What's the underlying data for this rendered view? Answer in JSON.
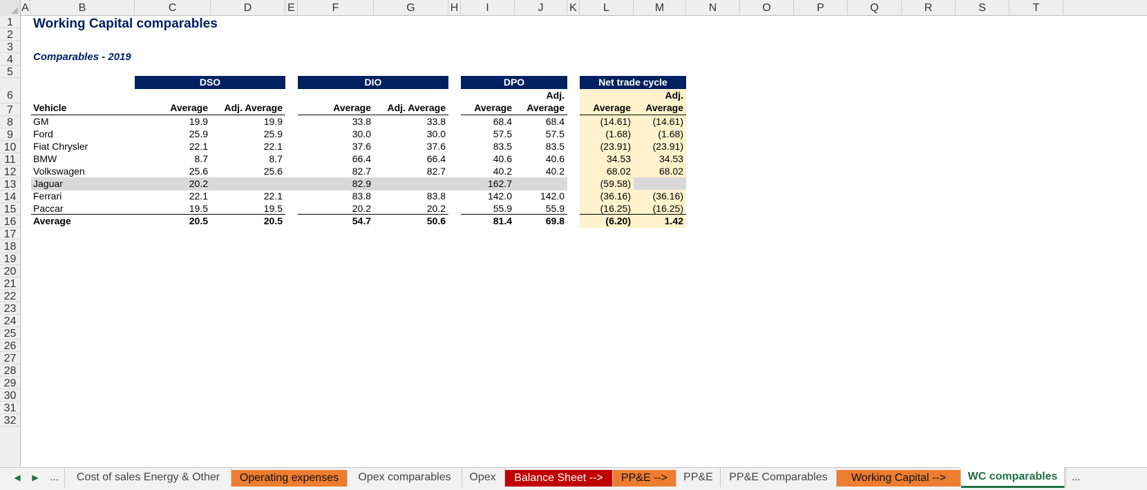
{
  "columns": [
    "A",
    "B",
    "C",
    "D",
    "E",
    "F",
    "G",
    "H",
    "I",
    "J",
    "K",
    "L",
    "M",
    "N",
    "O",
    "P",
    "Q",
    "R",
    "S",
    "T"
  ],
  "rows": [
    "1",
    "2",
    "3",
    "4",
    "5",
    "6",
    "7",
    "8",
    "9",
    "10",
    "11",
    "12",
    "13",
    "14",
    "15",
    "16",
    "17",
    "18",
    "19",
    "20",
    "21",
    "22",
    "23",
    "24",
    "25",
    "26",
    "27",
    "28",
    "29",
    "30",
    "31",
    "32"
  ],
  "sheet": {
    "title": "Working Capital comparables",
    "subtitle": "Comparables - 2019",
    "groups": [
      "DSO",
      "DIO",
      "DPO",
      "Net trade cycle"
    ],
    "header_adj": "Adj.",
    "header_average": "Average",
    "header_adj_average": "Adj. Average",
    "vehicle_label": "Vehicle",
    "data_rows": [
      {
        "name": "GM",
        "dso": "19.9",
        "dso_adj": "19.9",
        "dio": "33.8",
        "dio_adj": "33.8",
        "dpo": "68.4",
        "dpo_adj": "68.4",
        "ntc": "(14.61)",
        "ntc_adj": "(14.61)",
        "excluded": false
      },
      {
        "name": "Ford",
        "dso": "25.9",
        "dso_adj": "25.9",
        "dio": "30.0",
        "dio_adj": "30.0",
        "dpo": "57.5",
        "dpo_adj": "57.5",
        "ntc": "(1.68)",
        "ntc_adj": "(1.68)",
        "excluded": false
      },
      {
        "name": "Fiat Chrysler",
        "dso": "22.1",
        "dso_adj": "22.1",
        "dio": "37.6",
        "dio_adj": "37.6",
        "dpo": "83.5",
        "dpo_adj": "83.5",
        "ntc": "(23.91)",
        "ntc_adj": "(23.91)",
        "excluded": false
      },
      {
        "name": "BMW",
        "dso": "8.7",
        "dso_adj": "8.7",
        "dio": "66.4",
        "dio_adj": "66.4",
        "dpo": "40.6",
        "dpo_adj": "40.6",
        "ntc": "34.53",
        "ntc_adj": "34.53",
        "excluded": false
      },
      {
        "name": "Volkswagen",
        "dso": "25.6",
        "dso_adj": "25.6",
        "dio": "82.7",
        "dio_adj": "82.7",
        "dpo": "40.2",
        "dpo_adj": "40.2",
        "ntc": "68.02",
        "ntc_adj": "68.02",
        "excluded": false
      },
      {
        "name": "Jaguar",
        "dso": "20.2",
        "dso_adj": "",
        "dio": "82.9",
        "dio_adj": "",
        "dpo": "162.7",
        "dpo_adj": "",
        "ntc": "(59.58)",
        "ntc_adj": "",
        "excluded": true
      },
      {
        "name": "Ferrari",
        "dso": "22.1",
        "dso_adj": "22.1",
        "dio": "83.8",
        "dio_adj": "83.8",
        "dpo": "142.0",
        "dpo_adj": "142.0",
        "ntc": "(36.16)",
        "ntc_adj": "(36.16)",
        "excluded": false
      },
      {
        "name": "Paccar",
        "dso": "19.5",
        "dso_adj": "19.5",
        "dio": "20.2",
        "dio_adj": "20.2",
        "dpo": "55.9",
        "dpo_adj": "55.9",
        "ntc": "(16.25)",
        "ntc_adj": "(16.25)",
        "excluded": false
      }
    ],
    "average_row": {
      "name": "Average",
      "dso": "20.5",
      "dso_adj": "20.5",
      "dio": "54.7",
      "dio_adj": "50.6",
      "dpo": "81.4",
      "dpo_adj": "69.8",
      "ntc": "(6.20)",
      "ntc_adj": "1.42"
    }
  },
  "tabs": {
    "nav_prev": "◀",
    "nav_next": "▶",
    "more_left": "...",
    "more_right": "...",
    "items": [
      {
        "label": "Cost of sales Energy & Other",
        "color": ""
      },
      {
        "label": "Operating expenses",
        "color": "#ed7d31"
      },
      {
        "label": "Opex comparables",
        "color": ""
      },
      {
        "label": "Opex",
        "color": ""
      },
      {
        "label": "Balance Sheet -->",
        "color": "#c00000"
      },
      {
        "label": "PP&E -->",
        "color": "#ed7d31"
      },
      {
        "label": "PP&E",
        "color": ""
      },
      {
        "label": "PP&E Comparables",
        "color": ""
      },
      {
        "label": "Working Capital -->",
        "color": "#ed7d31"
      },
      {
        "label": "WC comparables",
        "color": "",
        "active": true
      }
    ]
  }
}
